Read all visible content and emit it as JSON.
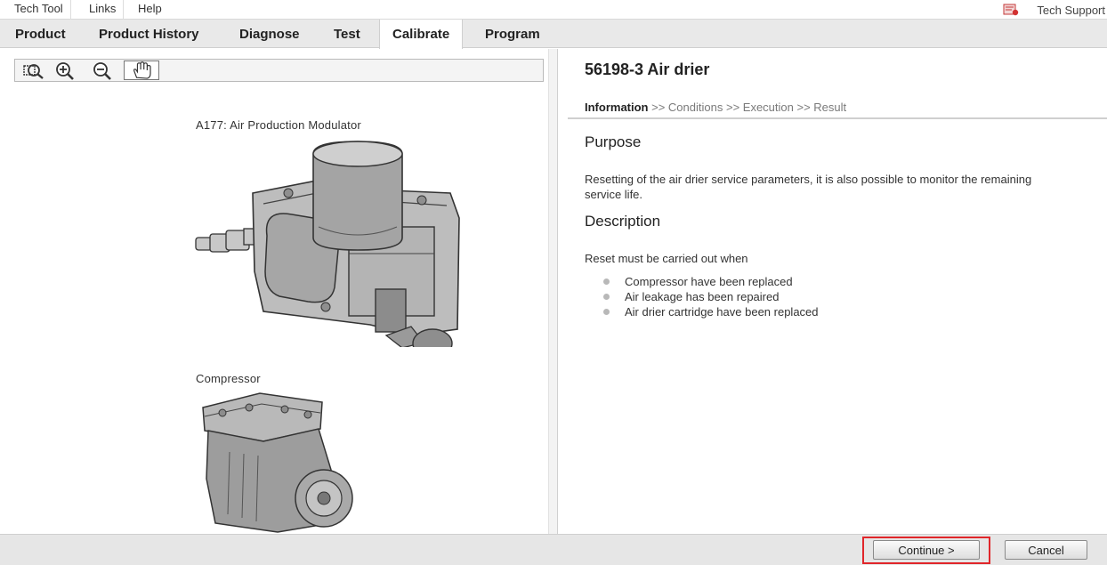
{
  "menubar": {
    "items": [
      "Tech Tool",
      "Links",
      "Help"
    ],
    "support_label": "Tech Support"
  },
  "tabs": [
    {
      "label": "Product",
      "active": false
    },
    {
      "label": "Product History",
      "active": false
    },
    {
      "label": "Diagnose",
      "active": false
    },
    {
      "label": "Test",
      "active": false
    },
    {
      "label": "Calibrate",
      "active": true
    },
    {
      "label": "Program",
      "active": false
    }
  ],
  "image_viewer": {
    "tools": [
      "zoom-area-icon",
      "zoom-in-icon",
      "zoom-out-icon",
      "pan-hand-icon"
    ],
    "selected_tool": "pan-hand-icon",
    "parts": [
      {
        "label": "A177: Air Production Modulator"
      },
      {
        "label": "Compressor"
      }
    ]
  },
  "operation": {
    "title": "56198-3 Air drier",
    "steps": {
      "current": "Information",
      "rest": [
        ">> Conditions",
        ">> Execution",
        ">> Result"
      ]
    },
    "purpose_heading": "Purpose",
    "purpose_text": "Resetting of the air drier service parameters, it is also possible to monitor the remaining service life.",
    "description_heading": "Description",
    "description_intro": "Reset must be carried out when",
    "bullets": [
      "Compressor have been replaced",
      "Air leakage has been repaired",
      "Air drier cartridge have been replaced"
    ]
  },
  "footer": {
    "continue_label": "Continue >",
    "cancel_label": "Cancel"
  },
  "colors": {
    "highlight": "#e0262a",
    "tabbar": "#e9e9e9",
    "footer": "#e6e6e6"
  }
}
